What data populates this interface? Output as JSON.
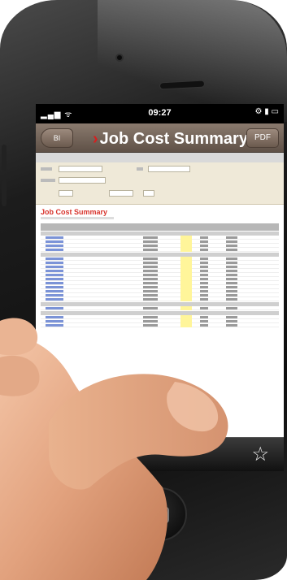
{
  "status_bar": {
    "signal": "▂▄▆ ᯤ",
    "time": "09:27",
    "right_icons": "⚙ ▮ ▭"
  },
  "navbar": {
    "back_label": "BI",
    "title_arrow": "›",
    "title": "Job Cost Summary",
    "pdf_label": "PDF"
  },
  "report": {
    "title": "Job Cost Summary"
  },
  "icons": {
    "star": "☆"
  },
  "colors": {
    "accent_red": "#d8332c",
    "navbar_brown": "#6b5a4e",
    "filter_bg": "#efe9d8",
    "highlight_yellow": "#fff59a"
  }
}
